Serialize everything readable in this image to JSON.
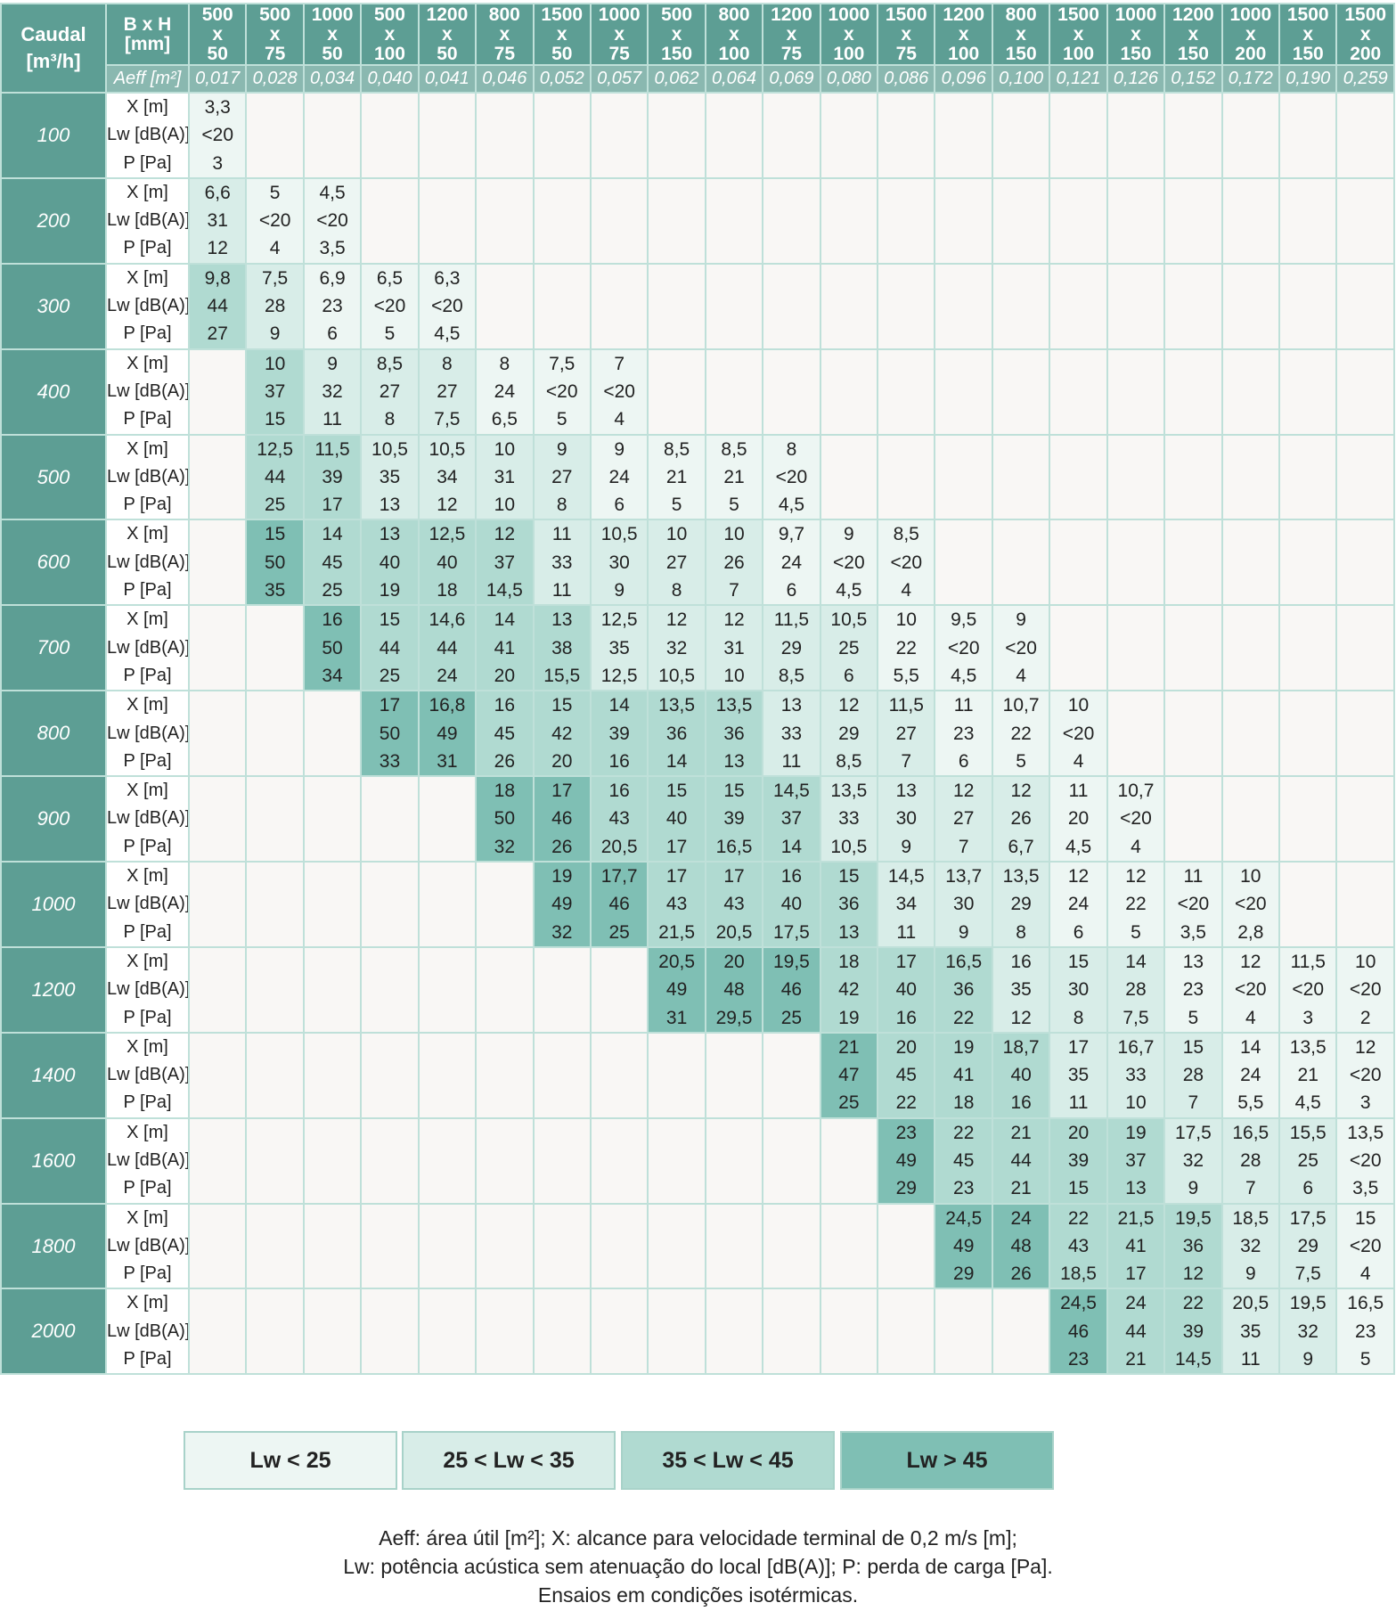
{
  "header": {
    "caudal_l1": "Caudal",
    "caudal_l2": "[m³/h]",
    "bxh_l1": "B x H",
    "bxh_l2": "[mm]",
    "aeff_label": "Aeff [m²]",
    "sep": "x"
  },
  "columns": [
    {
      "b": "500",
      "h": "50",
      "aeff": "0,017"
    },
    {
      "b": "500",
      "h": "75",
      "aeff": "0,028"
    },
    {
      "b": "1000",
      "h": "50",
      "aeff": "0,034"
    },
    {
      "b": "500",
      "h": "100",
      "aeff": "0,040"
    },
    {
      "b": "1200",
      "h": "50",
      "aeff": "0,041"
    },
    {
      "b": "800",
      "h": "75",
      "aeff": "0,046"
    },
    {
      "b": "1500",
      "h": "50",
      "aeff": "0,052"
    },
    {
      "b": "1000",
      "h": "75",
      "aeff": "0,057"
    },
    {
      "b": "500",
      "h": "150",
      "aeff": "0,062"
    },
    {
      "b": "800",
      "h": "100",
      "aeff": "0,064"
    },
    {
      "b": "1200",
      "h": "75",
      "aeff": "0,069"
    },
    {
      "b": "1000",
      "h": "100",
      "aeff": "0,080"
    },
    {
      "b": "1500",
      "h": "75",
      "aeff": "0,086"
    },
    {
      "b": "1200",
      "h": "100",
      "aeff": "0,096"
    },
    {
      "b": "800",
      "h": "150",
      "aeff": "0,100"
    },
    {
      "b": "1500",
      "h": "100",
      "aeff": "0,121"
    },
    {
      "b": "1000",
      "h": "150",
      "aeff": "0,126"
    },
    {
      "b": "1200",
      "h": "150",
      "aeff": "0,152"
    },
    {
      "b": "1000",
      "h": "200",
      "aeff": "0,172"
    },
    {
      "b": "1500",
      "h": "150",
      "aeff": "0,190"
    },
    {
      "b": "1500",
      "h": "200",
      "aeff": "0,259"
    }
  ],
  "param_labels": [
    "X [m]",
    "Lw [dB(A)]",
    "P [Pa]"
  ],
  "rows": [
    {
      "flow": "100",
      "start": 0,
      "cells": [
        [
          "3,3",
          "<20",
          "3",
          1
        ]
      ]
    },
    {
      "flow": "200",
      "start": 0,
      "cells": [
        [
          "6,6",
          "31",
          "12",
          2
        ],
        [
          "5",
          "<20",
          "4",
          1
        ],
        [
          "4,5",
          "<20",
          "3,5",
          1
        ]
      ]
    },
    {
      "flow": "300",
      "start": 0,
      "cells": [
        [
          "9,8",
          "44",
          "27",
          3
        ],
        [
          "7,5",
          "28",
          "9",
          2
        ],
        [
          "6,9",
          "23",
          "6",
          1
        ],
        [
          "6,5",
          "<20",
          "5",
          1
        ],
        [
          "6,3",
          "<20",
          "4,5",
          1
        ]
      ]
    },
    {
      "flow": "400",
      "start": 1,
      "cells": [
        [
          "10",
          "37",
          "15",
          3
        ],
        [
          "9",
          "32",
          "11",
          2
        ],
        [
          "8,5",
          "27",
          "8",
          2
        ],
        [
          "8",
          "27",
          "7,5",
          2
        ],
        [
          "8",
          "24",
          "6,5",
          1
        ],
        [
          "7,5",
          "<20",
          "5",
          1
        ],
        [
          "7",
          "<20",
          "4",
          1
        ]
      ]
    },
    {
      "flow": "500",
      "start": 1,
      "cells": [
        [
          "12,5",
          "44",
          "25",
          3
        ],
        [
          "11,5",
          "39",
          "17",
          3
        ],
        [
          "10,5",
          "35",
          "13",
          2
        ],
        [
          "10,5",
          "34",
          "12",
          2
        ],
        [
          "10",
          "31",
          "10",
          2
        ],
        [
          "9",
          "27",
          "8",
          2
        ],
        [
          "9",
          "24",
          "6",
          1
        ],
        [
          "8,5",
          "21",
          "5",
          1
        ],
        [
          "8,5",
          "21",
          "5",
          1
        ],
        [
          "8",
          "<20",
          "4,5",
          1
        ]
      ]
    },
    {
      "flow": "600",
      "start": 1,
      "cells": [
        [
          "15",
          "50",
          "35",
          4
        ],
        [
          "14",
          "45",
          "25",
          3
        ],
        [
          "13",
          "40",
          "19",
          3
        ],
        [
          "12,5",
          "40",
          "18",
          3
        ],
        [
          "12",
          "37",
          "14,5",
          3
        ],
        [
          "11",
          "33",
          "11",
          2
        ],
        [
          "10,5",
          "30",
          "9",
          2
        ],
        [
          "10",
          "27",
          "8",
          2
        ],
        [
          "10",
          "26",
          "7",
          2
        ],
        [
          "9,7",
          "24",
          "6",
          1
        ],
        [
          "9",
          "<20",
          "4,5",
          1
        ],
        [
          "8,5",
          "<20",
          "4",
          1
        ]
      ]
    },
    {
      "flow": "700",
      "start": 2,
      "cells": [
        [
          "16",
          "50",
          "34",
          4
        ],
        [
          "15",
          "44",
          "25",
          3
        ],
        [
          "14,6",
          "44",
          "24",
          3
        ],
        [
          "14",
          "41",
          "20",
          3
        ],
        [
          "13",
          "38",
          "15,5",
          3
        ],
        [
          "12,5",
          "35",
          "12,5",
          2
        ],
        [
          "12",
          "32",
          "10,5",
          2
        ],
        [
          "12",
          "31",
          "10",
          2
        ],
        [
          "11,5",
          "29",
          "8,5",
          2
        ],
        [
          "10,5",
          "25",
          "6",
          2
        ],
        [
          "10",
          "22",
          "5,5",
          1
        ],
        [
          "9,5",
          "<20",
          "4,5",
          1
        ],
        [
          "9",
          "<20",
          "4",
          1
        ]
      ]
    },
    {
      "flow": "800",
      "start": 3,
      "cells": [
        [
          "17",
          "50",
          "33",
          4
        ],
        [
          "16,8",
          "49",
          "31",
          4
        ],
        [
          "16",
          "45",
          "26",
          3
        ],
        [
          "15",
          "42",
          "20",
          3
        ],
        [
          "14",
          "39",
          "16",
          3
        ],
        [
          "13,5",
          "36",
          "14",
          3
        ],
        [
          "13,5",
          "36",
          "13",
          3
        ],
        [
          "13",
          "33",
          "11",
          2
        ],
        [
          "12",
          "29",
          "8,5",
          2
        ],
        [
          "11,5",
          "27",
          "7",
          2
        ],
        [
          "11",
          "23",
          "6",
          1
        ],
        [
          "10,7",
          "22",
          "5",
          1
        ],
        [
          "10",
          "<20",
          "4",
          1
        ]
      ]
    },
    {
      "flow": "900",
      "start": 5,
      "cells": [
        [
          "18",
          "50",
          "32",
          4
        ],
        [
          "17",
          "46",
          "26",
          4
        ],
        [
          "16",
          "43",
          "20,5",
          3
        ],
        [
          "15",
          "40",
          "17",
          3
        ],
        [
          "15",
          "39",
          "16,5",
          3
        ],
        [
          "14,5",
          "37",
          "14",
          3
        ],
        [
          "13,5",
          "33",
          "10,5",
          2
        ],
        [
          "13",
          "30",
          "9",
          2
        ],
        [
          "12",
          "27",
          "7",
          2
        ],
        [
          "12",
          "26",
          "6,7",
          2
        ],
        [
          "11",
          "20",
          "4,5",
          1
        ],
        [
          "10,7",
          "<20",
          "4",
          1
        ]
      ]
    },
    {
      "flow": "1000",
      "start": 6,
      "cells": [
        [
          "19",
          "49",
          "32",
          4
        ],
        [
          "17,7",
          "46",
          "25",
          4
        ],
        [
          "17",
          "43",
          "21,5",
          3
        ],
        [
          "17",
          "43",
          "20,5",
          3
        ],
        [
          "16",
          "40",
          "17,5",
          3
        ],
        [
          "15",
          "36",
          "13",
          3
        ],
        [
          "14,5",
          "34",
          "11",
          2
        ],
        [
          "13,7",
          "30",
          "9",
          2
        ],
        [
          "13,5",
          "29",
          "8",
          2
        ],
        [
          "12",
          "24",
          "6",
          1
        ],
        [
          "12",
          "22",
          "5",
          1
        ],
        [
          "11",
          "<20",
          "3,5",
          1
        ],
        [
          "10",
          "<20",
          "2,8",
          1
        ]
      ]
    },
    {
      "flow": "1200",
      "start": 8,
      "cells": [
        [
          "20,5",
          "49",
          "31",
          4
        ],
        [
          "20",
          "48",
          "29,5",
          4
        ],
        [
          "19,5",
          "46",
          "25",
          4
        ],
        [
          "18",
          "42",
          "19",
          3
        ],
        [
          "17",
          "40",
          "16",
          3
        ],
        [
          "16,5",
          "36",
          "22",
          3
        ],
        [
          "16",
          "35",
          "12",
          2
        ],
        [
          "15",
          "30",
          "8",
          2
        ],
        [
          "14",
          "28",
          "7,5",
          2
        ],
        [
          "13",
          "23",
          "5",
          1
        ],
        [
          "12",
          "<20",
          "4",
          1
        ],
        [
          "11,5",
          "<20",
          "3",
          1
        ],
        [
          "10",
          "<20",
          "2",
          1
        ]
      ]
    },
    {
      "flow": "1400",
      "start": 11,
      "cells": [
        [
          "21",
          "47",
          "25",
          4
        ],
        [
          "20",
          "45",
          "22",
          3
        ],
        [
          "19",
          "41",
          "18",
          3
        ],
        [
          "18,7",
          "40",
          "16",
          3
        ],
        [
          "17",
          "35",
          "11",
          2
        ],
        [
          "16,7",
          "33",
          "10",
          2
        ],
        [
          "15",
          "28",
          "7",
          2
        ],
        [
          "14",
          "24",
          "5,5",
          1
        ],
        [
          "13,5",
          "21",
          "4,5",
          1
        ],
        [
          "12",
          "<20",
          "3",
          1
        ]
      ]
    },
    {
      "flow": "1600",
      "start": 12,
      "cells": [
        [
          "23",
          "49",
          "29",
          4
        ],
        [
          "22",
          "45",
          "23",
          3
        ],
        [
          "21",
          "44",
          "21",
          3
        ],
        [
          "20",
          "39",
          "15",
          3
        ],
        [
          "19",
          "37",
          "13",
          3
        ],
        [
          "17,5",
          "32",
          "9",
          2
        ],
        [
          "16,5",
          "28",
          "7",
          2
        ],
        [
          "15,5",
          "25",
          "6",
          2
        ],
        [
          "13,5",
          "<20",
          "3,5",
          1
        ]
      ]
    },
    {
      "flow": "1800",
      "start": 13,
      "cells": [
        [
          "24,5",
          "49",
          "29",
          4
        ],
        [
          "24",
          "48",
          "26",
          4
        ],
        [
          "22",
          "43",
          "18,5",
          3
        ],
        [
          "21,5",
          "41",
          "17",
          3
        ],
        [
          "19,5",
          "36",
          "12",
          3
        ],
        [
          "18,5",
          "32",
          "9",
          2
        ],
        [
          "17,5",
          "29",
          "7,5",
          2
        ],
        [
          "15",
          "<20",
          "4",
          1
        ]
      ]
    },
    {
      "flow": "2000",
      "start": 15,
      "cells": [
        [
          "24,5",
          "46",
          "23",
          4
        ],
        [
          "24",
          "44",
          "21",
          3
        ],
        [
          "22",
          "39",
          "14,5",
          3
        ],
        [
          "20,5",
          "35",
          "11",
          2
        ],
        [
          "19,5",
          "32",
          "9",
          2
        ],
        [
          "16,5",
          "23",
          "5",
          1
        ]
      ]
    }
  ],
  "legend": [
    {
      "label": "Lw < 25",
      "color": "#edf6f3"
    },
    {
      "label": "25 < Lw < 35",
      "color": "#d8ede8"
    },
    {
      "label": "35 < Lw < 45",
      "color": "#b0dad1"
    },
    {
      "label": "Lw > 45",
      "color": "#7fbfb4"
    }
  ],
  "notes": [
    "Aeff: área útil [m²]; X: alcance para velocidade terminal de 0,2 m/s [m];",
    "Lw: potência acústica sem atenuação do local [dB(A)]; P: perda de carga [Pa].",
    "Ensaios em condições isotérmicas."
  ]
}
